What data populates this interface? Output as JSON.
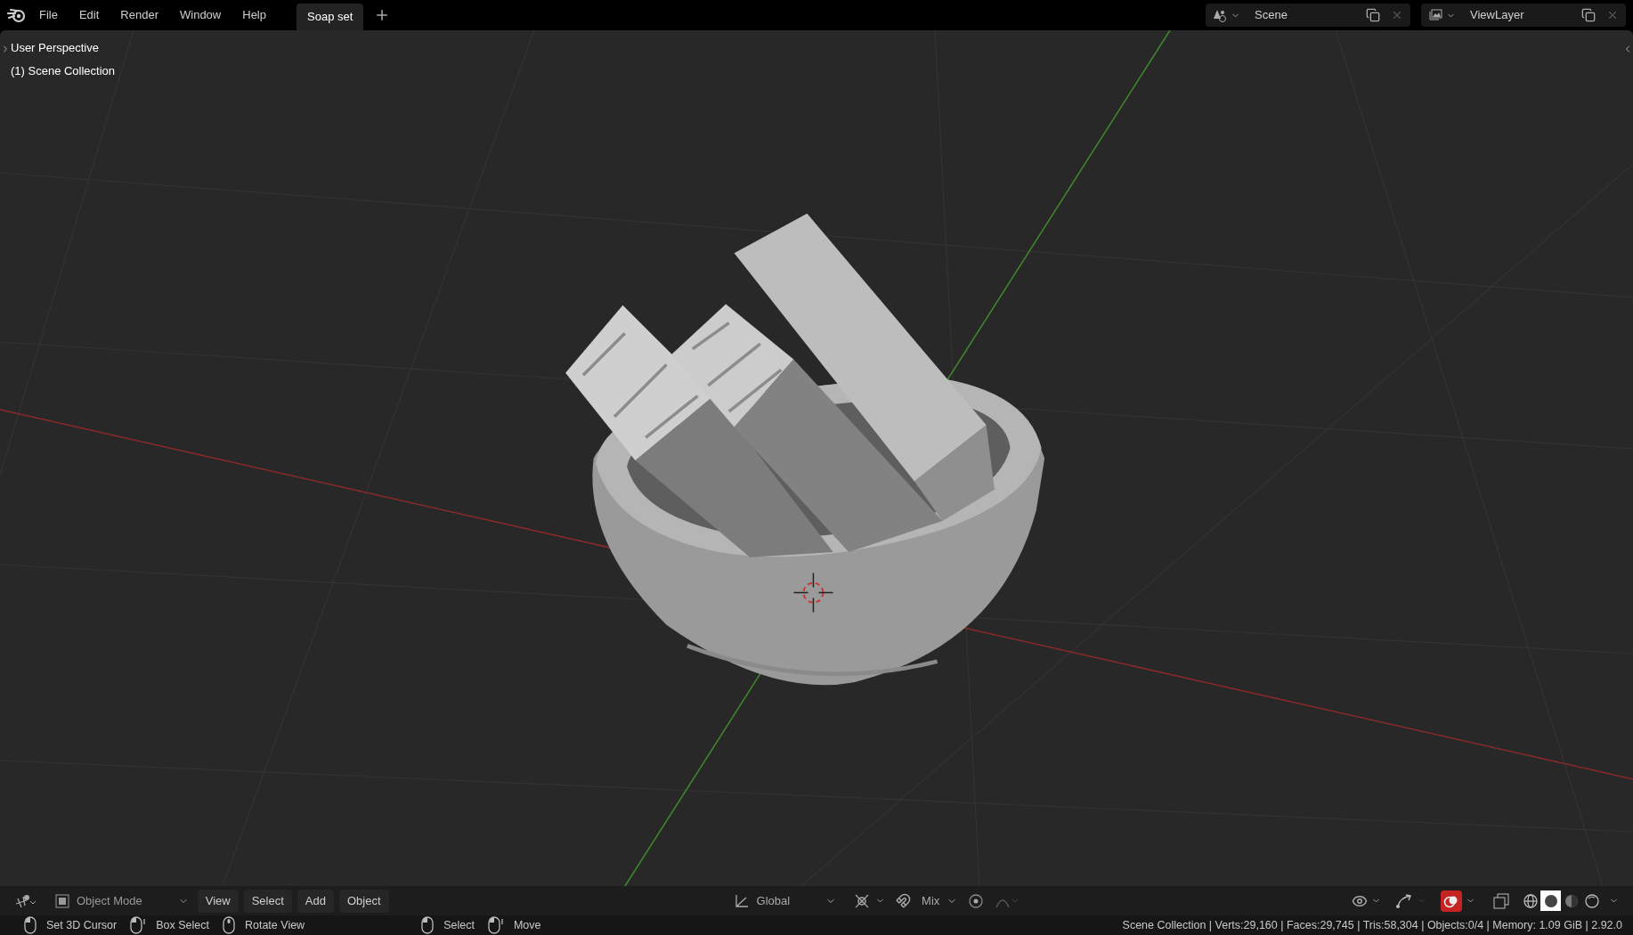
{
  "top_bar": {
    "menus": [
      "File",
      "Edit",
      "Render",
      "Window",
      "Help"
    ],
    "workspace_tabs": [
      {
        "label": "Soap set",
        "selected": true
      }
    ],
    "scene": "Scene",
    "view_layer": "ViewLayer"
  },
  "viewport": {
    "view_name": "User Perspective",
    "collection": "(1) Scene Collection"
  },
  "header": {
    "mode": "Object Mode",
    "menus": [
      "View",
      "Select",
      "Add",
      "Object"
    ],
    "transform_orientation": "Global",
    "snap_mode": "Mix",
    "overlays_on": true,
    "shading_modes": [
      {
        "kind": "wireframe",
        "selected": false
      },
      {
        "kind": "solid",
        "selected": true
      },
      {
        "kind": "material",
        "selected": false
      },
      {
        "kind": "rendered",
        "selected": false
      }
    ]
  },
  "status_bar": {
    "hints": [
      {
        "kind": "left",
        "label": "Set 3D Cursor"
      },
      {
        "kind": "drag",
        "label": "Box Select"
      },
      {
        "kind": "middle",
        "label": "Rotate View"
      },
      {
        "kind": "left",
        "label": "Select"
      },
      {
        "kind": "drag",
        "label": "Move"
      }
    ],
    "stats": "Scene Collection | Verts:29,160 | Faces:29,745 | Tris:58,304 | Objects:0/4 | Memory: 1.09 GiB | 2.92.0"
  }
}
